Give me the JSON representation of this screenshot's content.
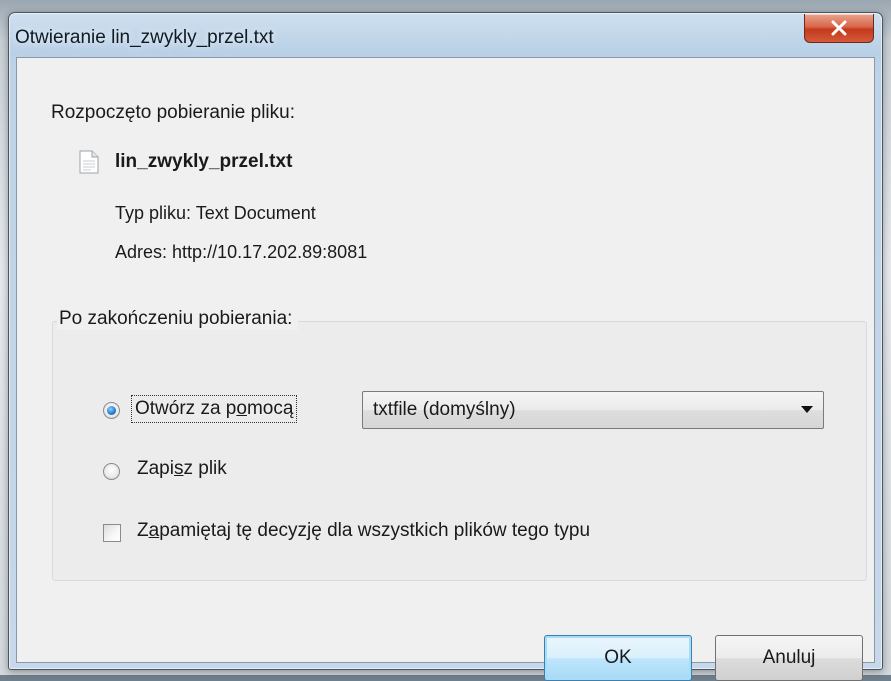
{
  "window": {
    "title": "Otwieranie lin_zwykly_przel.txt"
  },
  "dialog": {
    "heading": "Rozpoczęto pobieranie pliku:",
    "file_name": "lin_zwykly_przel.txt",
    "type_label": "Typ pliku:",
    "type_value": "Text Document",
    "address_label": "Adres:",
    "address_value": "http://10.17.202.89:8081"
  },
  "after_download": {
    "legend": "Po zakończeniu pobierania:",
    "open_with": {
      "label_pre": "Otwórz za p",
      "label_access": "o",
      "label_post": "mocą",
      "selected": true
    },
    "open_with_select": {
      "value": "txtfile (domyślny)"
    },
    "save_file": {
      "label_pre": "Zapi",
      "label_access": "s",
      "label_post": "z plik",
      "selected": false
    },
    "remember": {
      "label_pre": "Z",
      "label_access": "a",
      "label_post": "pamiętaj tę decyzję dla wszystkich plików tego typu",
      "checked": false
    }
  },
  "buttons": {
    "ok": "OK",
    "cancel": "Anuluj"
  },
  "colors": {
    "client_bg": "#f0f0f0",
    "close_button": "#c4391b",
    "default_button_border": "#3c7fb1"
  },
  "icons": {
    "close": "close-icon",
    "file": "text-file-icon",
    "dropdown": "chevron-down-icon"
  }
}
